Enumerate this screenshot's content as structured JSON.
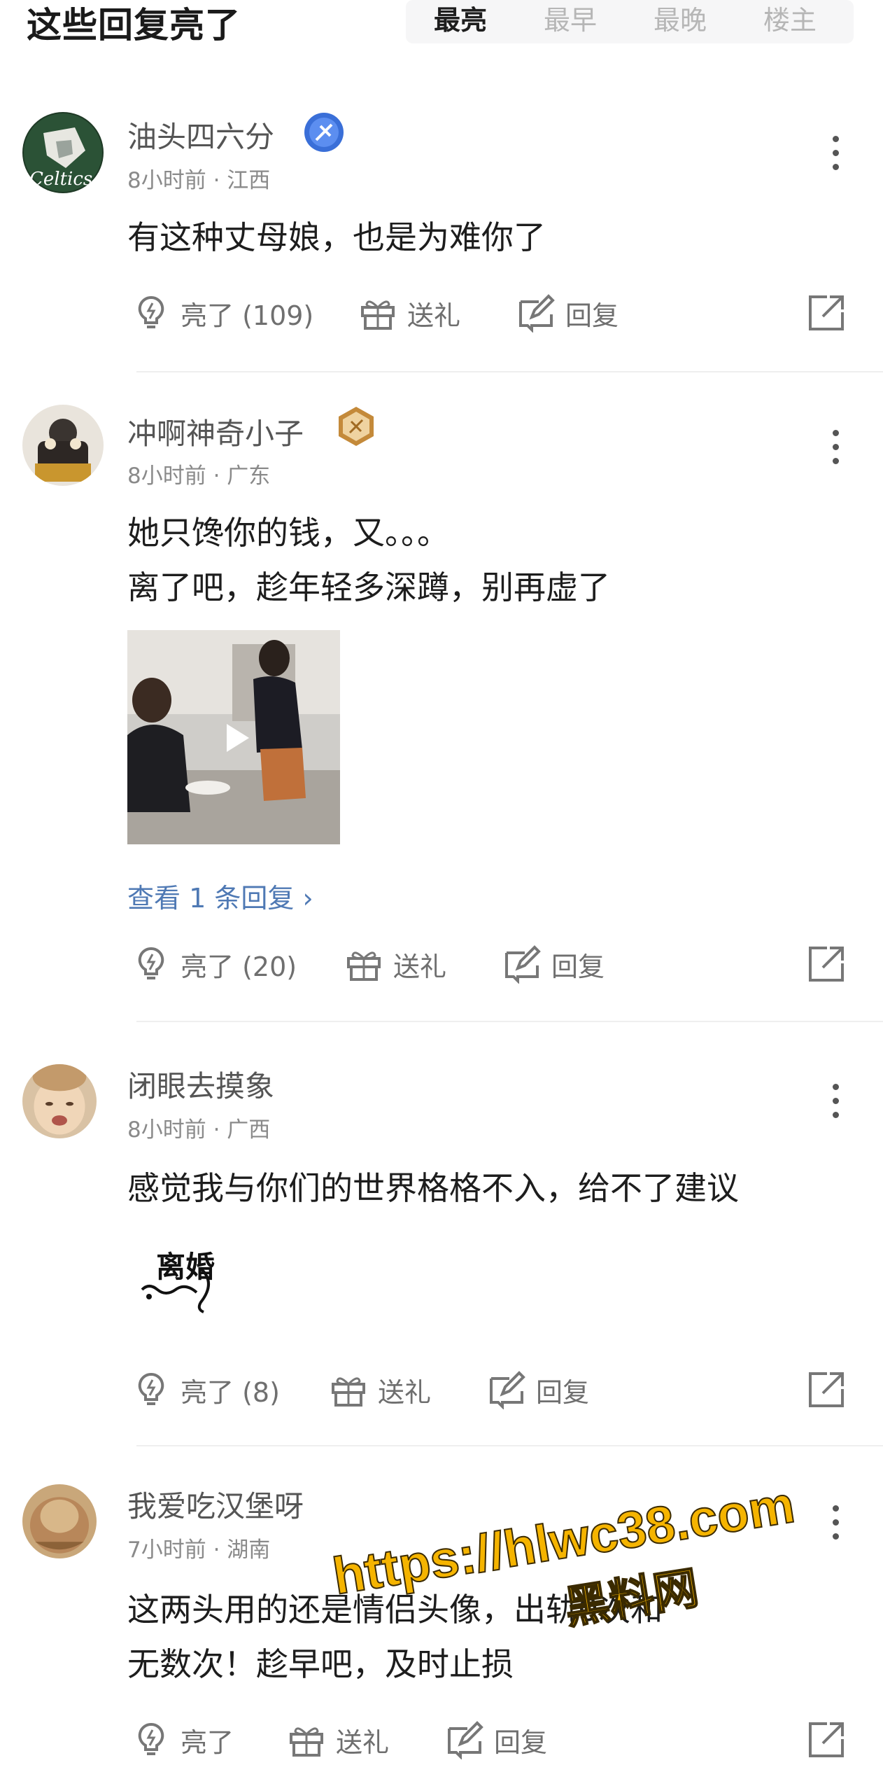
{
  "header": {
    "title": "这些回复亮了",
    "tabs": [
      {
        "label": "最亮",
        "active": true
      },
      {
        "label": "最早",
        "active": false
      },
      {
        "label": "最晚",
        "active": false
      },
      {
        "label": "楼主",
        "active": false
      }
    ]
  },
  "comments": [
    {
      "username": "油头四六分",
      "badge_icon": "blue-rank-badge-icon",
      "time": "8小时前",
      "location": "江西",
      "lines": [
        "有这种丈母娘，也是为难你了"
      ],
      "actions": {
        "like": "亮了 (109)",
        "gift": "送礼",
        "reply": "回复"
      }
    },
    {
      "username": "冲啊神奇小子",
      "badge_icon": "gold-rank-badge-icon",
      "time": "8小时前",
      "location": "广东",
      "lines": [
        "她只馋你的钱，又。。。",
        "离了吧，趁年轻多深蹲，别再虚了"
      ],
      "media": "video-thumbnail",
      "view_replies": "查看 1 条回复",
      "actions": {
        "like": "亮了 (20)",
        "gift": "送礼",
        "reply": "回复"
      }
    },
    {
      "username": "闭眼去摸象",
      "time": "8小时前",
      "location": "广西",
      "lines": [
        "感觉我与你们的世界格格不入，给不了建议"
      ],
      "sticker_text": "离婚",
      "actions": {
        "like": "亮了 (8)",
        "gift": "送礼",
        "reply": "回复"
      }
    },
    {
      "username": "我爱吃汉堡呀",
      "time": "7小时前",
      "location": "湖南",
      "lines": [
        "这两头用的还是情侣头像，出轨0次和",
        "无数次！趁早吧，及时止损"
      ],
      "actions": {
        "like": "亮了",
        "gift": "送礼",
        "reply": "回复"
      }
    }
  ],
  "watermark": {
    "url": "https://hlwc38.com",
    "name": "黑料网"
  },
  "colors": {
    "link": "#4f79b4",
    "watermark": "#f5b400",
    "meta": "#8a8a8a"
  }
}
